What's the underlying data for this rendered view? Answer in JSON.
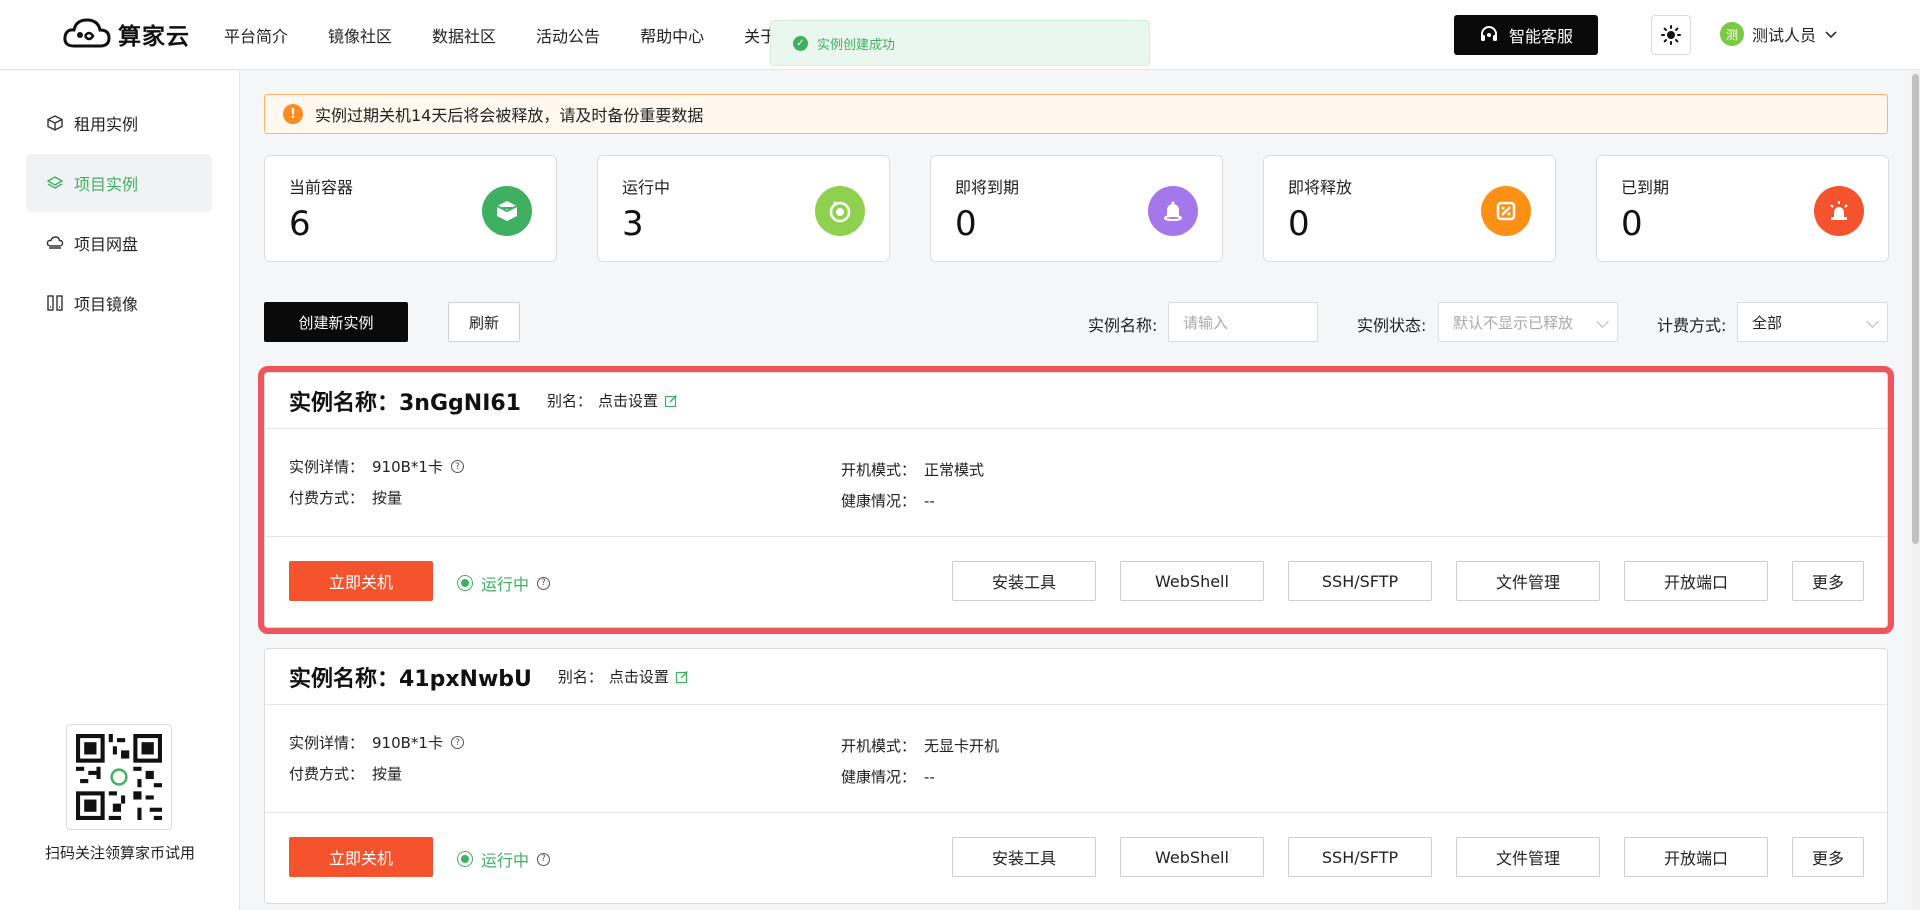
{
  "brand": {
    "name": "算家云"
  },
  "nav": [
    "平台简介",
    "镜像社区",
    "数据社区",
    "活动公告",
    "帮助中心",
    "关于"
  ],
  "toast": {
    "message": "实例创建成功"
  },
  "header": {
    "service_label": "智能客服",
    "user_initial": "测",
    "user_name": "测试人员"
  },
  "sidebar": {
    "items": [
      {
        "label": "租用实例",
        "icon": "cube-icon",
        "active": false
      },
      {
        "label": "项目实例",
        "icon": "layers-icon",
        "active": true
      },
      {
        "label": "项目网盘",
        "icon": "cloud-drive-icon",
        "active": false
      },
      {
        "label": "项目镜像",
        "icon": "mirror-icon",
        "active": false
      }
    ],
    "qr_caption": "扫码关注领算家币试用"
  },
  "notice": {
    "text": "实例过期关机14天后将会被释放，请及时备份重要数据"
  },
  "stats": [
    {
      "label": "当前容器",
      "value": "6",
      "color": "#3fb061",
      "icon": "container-icon"
    },
    {
      "label": "运行中",
      "value": "3",
      "color": "#8fd14f",
      "icon": "running-icon"
    },
    {
      "label": "即将到期",
      "value": "0",
      "color": "#a478ea",
      "icon": "bell-icon"
    },
    {
      "label": "即将释放",
      "value": "0",
      "color": "#ff9016",
      "icon": "release-icon"
    },
    {
      "label": "已到期",
      "value": "0",
      "color": "#f5532d",
      "icon": "alarm-icon"
    }
  ],
  "toolbar": {
    "create_label": "创建新实例",
    "refresh_label": "刷新",
    "name_label": "实例名称:",
    "name_placeholder": "请输入",
    "status_label": "实例状态:",
    "status_placeholder": "默认不显示已释放",
    "billing_label": "计费方式:",
    "billing_value": "全部"
  },
  "instances": [
    {
      "title": "实例名称：3nGgNI61",
      "alias_label": "别名：",
      "alias_value": "点击设置",
      "detail_label": "实例详情：",
      "detail_value": "910B*1卡",
      "pay_label": "付费方式：",
      "pay_value": "按量",
      "boot_label": "开机模式：",
      "boot_value": "正常模式",
      "health_label": "健康情况：",
      "health_value": "--",
      "stop_label": "立即关机",
      "status": "运行中",
      "actions": [
        "安装工具",
        "WebShell",
        "SSH/SFTP",
        "文件管理",
        "开放端口",
        "更多"
      ]
    },
    {
      "title": "实例名称：41pxNwbU",
      "alias_label": "别名：",
      "alias_value": "点击设置",
      "detail_label": "实例详情：",
      "detail_value": "910B*1卡",
      "pay_label": "付费方式：",
      "pay_value": "按量",
      "boot_label": "开机模式：",
      "boot_value": "无显卡开机",
      "health_label": "健康情况：",
      "health_value": "--",
      "stop_label": "立即关机",
      "status": "运行中",
      "actions": [
        "安装工具",
        "WebShell",
        "SSH/SFTP",
        "文件管理",
        "开放端口",
        "更多"
      ]
    }
  ],
  "colors": {
    "brand_green": "#3fb061",
    "danger": "#f5532d",
    "highlight": "#f0545d"
  }
}
